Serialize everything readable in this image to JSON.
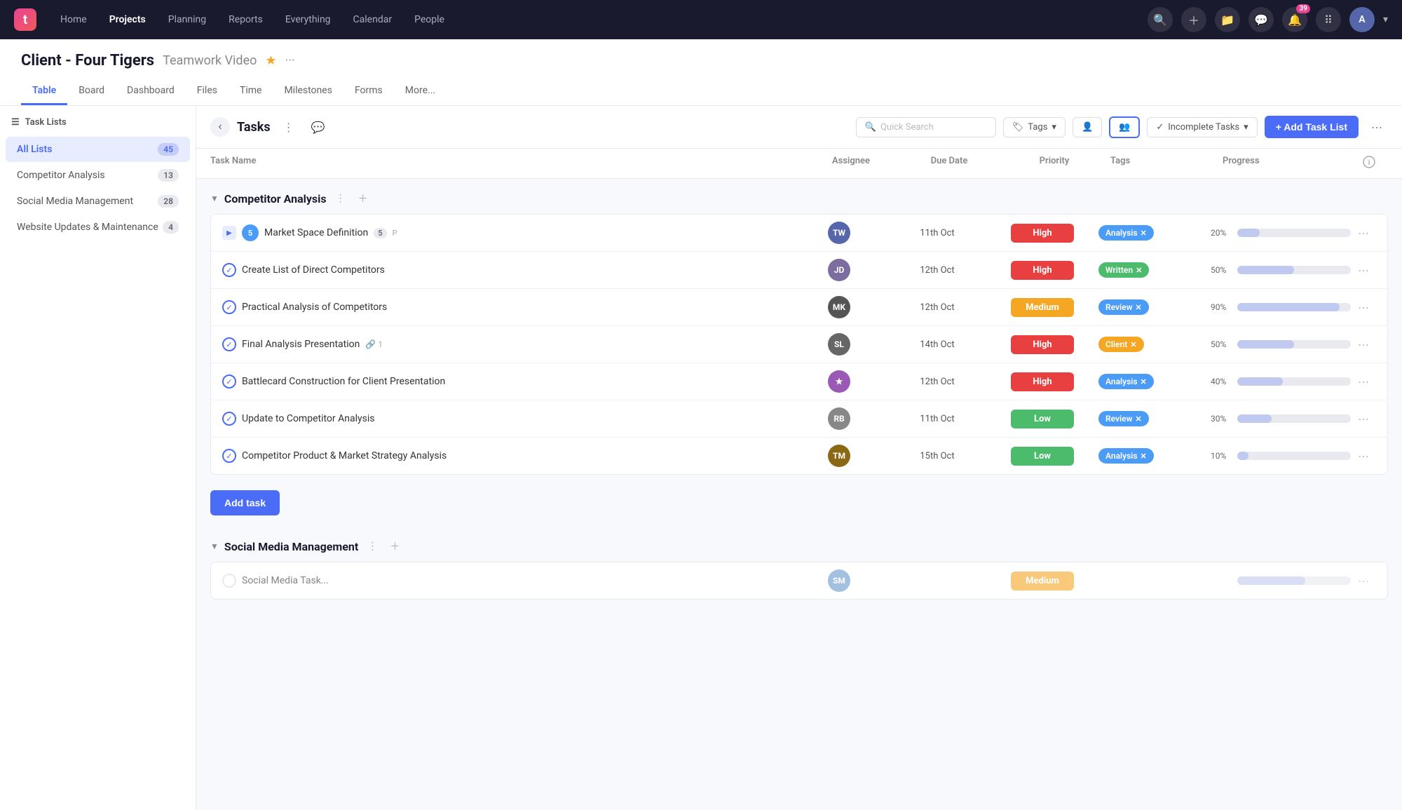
{
  "topnav": {
    "logo_text": "t",
    "links": [
      {
        "label": "Home",
        "active": false
      },
      {
        "label": "Projects",
        "active": true
      },
      {
        "label": "Planning",
        "active": false
      },
      {
        "label": "Reports",
        "active": false
      },
      {
        "label": "Everything",
        "active": false
      },
      {
        "label": "Calendar",
        "active": false
      },
      {
        "label": "People",
        "active": false
      }
    ],
    "notification_count": "39",
    "avatar_initials": "A"
  },
  "project": {
    "title": "Client - Four Tigers",
    "subtitle": "Teamwork Video"
  },
  "tabs": [
    {
      "label": "Table",
      "active": true
    },
    {
      "label": "Board",
      "active": false
    },
    {
      "label": "Dashboard",
      "active": false
    },
    {
      "label": "Files",
      "active": false
    },
    {
      "label": "Time",
      "active": false
    },
    {
      "label": "Milestones",
      "active": false
    },
    {
      "label": "Forms",
      "active": false
    },
    {
      "label": "More...",
      "active": false
    }
  ],
  "sidebar": {
    "header": "Task Lists",
    "items": [
      {
        "label": "All Lists",
        "count": "45",
        "active": true
      },
      {
        "label": "Competitor Analysis",
        "count": "13",
        "active": false
      },
      {
        "label": "Social Media Management",
        "count": "28",
        "active": false
      },
      {
        "label": "Website Updates & Maintenance",
        "count": "4",
        "active": false
      }
    ]
  },
  "toolbar": {
    "title": "Tasks",
    "search_placeholder": "Quick Search",
    "tags_label": "Tags",
    "incomplete_tasks_label": "Incomplete Tasks",
    "add_tasklist_label": "+ Add Task List"
  },
  "table": {
    "columns": [
      "Task Name",
      "Assignee",
      "Due Date",
      "Priority",
      "Tags",
      "Progress"
    ]
  },
  "competitor_analysis": {
    "section_title": "Competitor Analysis",
    "tasks": [
      {
        "name": "Market Space Definition",
        "sub_count": "5",
        "has_subtasks": true,
        "assignee_color": "#5566aa",
        "assignee_initials": "TW",
        "due_date": "11th Oct",
        "priority": "High",
        "priority_class": "priority-high",
        "tag_label": "Analysis",
        "tag_class": "tag-analysis",
        "progress": 20
      },
      {
        "name": "Create List of Direct Competitors",
        "has_subtasks": false,
        "assignee_color": "#7c6ca0",
        "assignee_initials": "JD",
        "due_date": "12th Oct",
        "priority": "High",
        "priority_class": "priority-high",
        "tag_label": "Written",
        "tag_class": "tag-written",
        "progress": 50
      },
      {
        "name": "Practical Analysis of Competitors",
        "has_subtasks": false,
        "assignee_color": "#444",
        "assignee_initials": "MK",
        "due_date": "12th Oct",
        "priority": "Medium",
        "priority_class": "priority-medium",
        "tag_label": "Review",
        "tag_class": "tag-review",
        "progress": 90
      },
      {
        "name": "Final Analysis Presentation",
        "link_count": "1",
        "has_subtasks": false,
        "assignee_color": "#555",
        "assignee_initials": "SL",
        "due_date": "14th Oct",
        "priority": "High",
        "priority_class": "priority-high",
        "tag_label": "Client",
        "tag_class": "tag-client",
        "progress": 50
      },
      {
        "name": "Battlecard Construction for Client Presentation",
        "has_subtasks": false,
        "assignee_color": "#9b59b6",
        "assignee_initials": "★",
        "due_date": "12th Oct",
        "priority": "High",
        "priority_class": "priority-high",
        "tag_label": "Analysis",
        "tag_class": "tag-analysis",
        "progress": 40
      },
      {
        "name": "Update to Competitor Analysis",
        "has_subtasks": false,
        "assignee_color": "#666",
        "assignee_initials": "RB",
        "due_date": "11th Oct",
        "priority": "Low",
        "priority_class": "priority-low",
        "tag_label": "Review",
        "tag_class": "tag-review",
        "progress": 30
      },
      {
        "name": "Competitor Product & Market Strategy Analysis",
        "has_subtasks": false,
        "assignee_color": "#8b4513",
        "assignee_initials": "TM",
        "due_date": "15th Oct",
        "priority": "Low",
        "priority_class": "priority-low",
        "tag_label": "Analysis",
        "tag_class": "tag-analysis",
        "progress": 10
      }
    ],
    "add_task_label": "Add task"
  },
  "social_media": {
    "section_title": "Social Media Management"
  }
}
